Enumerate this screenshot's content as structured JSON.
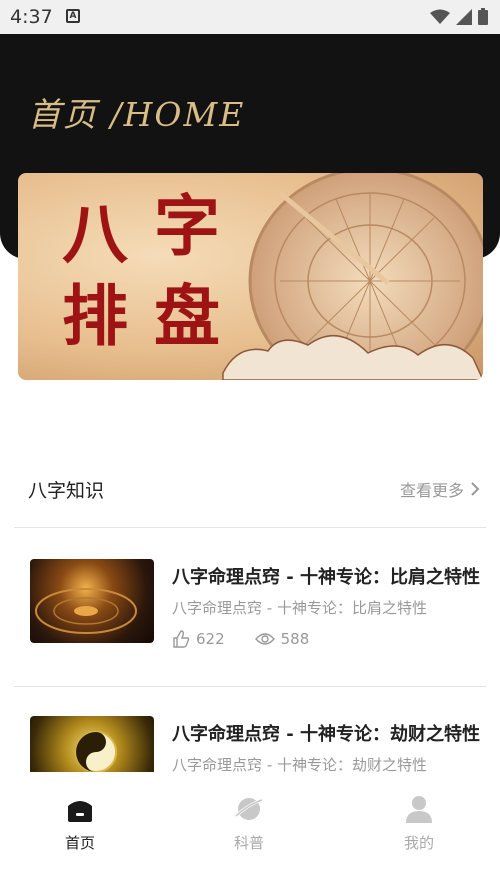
{
  "status_bar": {
    "time": "4:37",
    "app_icon": "A"
  },
  "header": {
    "title": "首页 /HOME"
  },
  "banner": {
    "chars": [
      "八",
      "字",
      "排",
      "盘"
    ]
  },
  "section": {
    "title": "八字知识",
    "more_label": "查看更多"
  },
  "articles": [
    {
      "title": "八字命理点窍 - 十神专论：比肩之特性",
      "subtitle": "八字命理点窍 - 十神专论：比肩之特性",
      "likes": "622",
      "views": "588"
    },
    {
      "title": "八字命理点窍 - 十神专论：劫财之特性",
      "subtitle": "八字命理点窍 - 十神专论：劫财之特性"
    }
  ],
  "bottom_nav": [
    {
      "label": "首页",
      "icon": "home-icon",
      "active": true
    },
    {
      "label": "科普",
      "icon": "science-icon",
      "active": false
    },
    {
      "label": "我的",
      "icon": "profile-icon",
      "active": false
    }
  ],
  "colors": {
    "header_bg": "#121212",
    "title_gold": "#d9bc86",
    "banner_red": "#9e1414",
    "muted": "#999999"
  }
}
